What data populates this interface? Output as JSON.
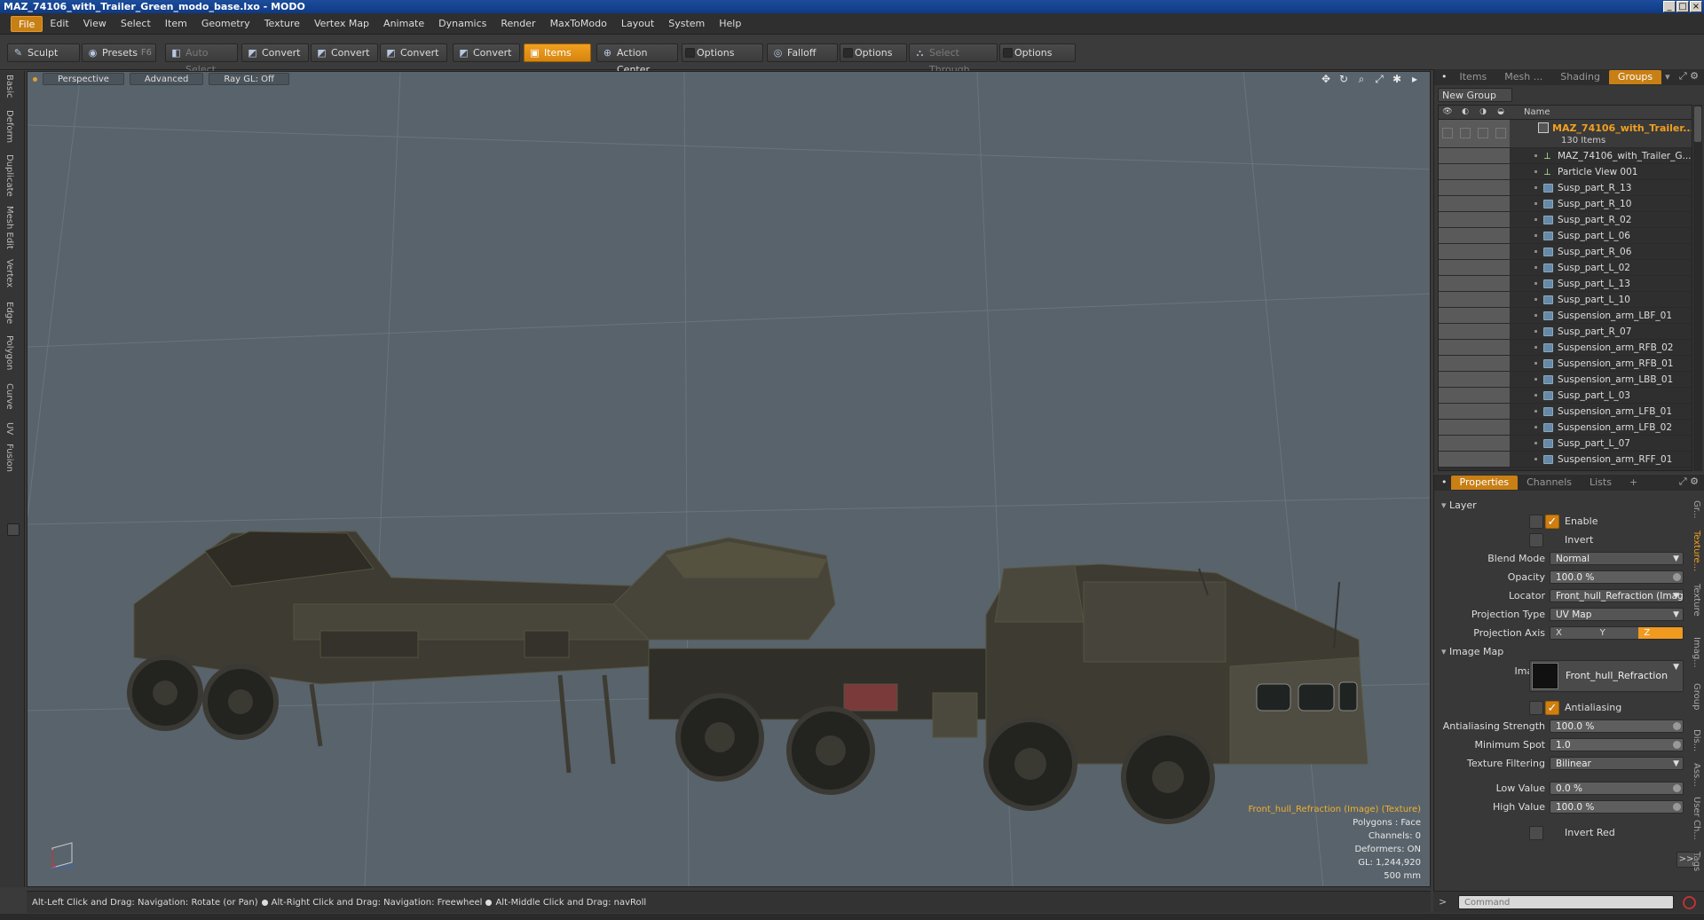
{
  "window": {
    "title": "MAZ_74106_with_Trailer_Green_modo_base.lxo - MODO"
  },
  "menu": [
    "File",
    "Edit",
    "View",
    "Select",
    "Item",
    "Geometry",
    "Texture",
    "Vertex Map",
    "Animate",
    "Dynamics",
    "Render",
    "MaxToModo",
    "Layout",
    "System",
    "Help"
  ],
  "toolbar": {
    "sculpt": "Sculpt",
    "presets": "Presets",
    "presets_key": "F6",
    "auto_select": "Auto Select",
    "convert": "Convert",
    "items": "Items",
    "action_center": "Action Center",
    "options": "Options",
    "falloff": "Falloff",
    "select_through": "Select Through"
  },
  "left_tabs": [
    "Basic",
    "Deform",
    "Duplicate",
    "Mesh Edit",
    "Vertex",
    "Edge",
    "Polygon",
    "Curve",
    "UV",
    "Fusion"
  ],
  "viewport": {
    "perspective": "Perspective",
    "advanced": "Advanced",
    "raygl": "Ray GL: Off",
    "info": {
      "selected": "Front_hull_Refraction (Image) (Texture)",
      "polygons": "Polygons : Face",
      "channels": "Channels: 0",
      "deformers": "Deformers: ON",
      "gl": "GL: 1,244,920",
      "scale": "500 mm"
    }
  },
  "statusbar": {
    "hint1": "Alt-Left Click and Drag: Navigation: Rotate (or Pan)",
    "hint2": "Alt-Right Click and Drag: Navigation: Freewheel",
    "hint3": "Alt-Middle Click and Drag: navRoll"
  },
  "groups_panel": {
    "tabs": [
      "Items",
      "Mesh ...",
      "Shading",
      "Groups"
    ],
    "selected_tab": "Groups",
    "new_group": "New Group",
    "col_name": "Name",
    "root_name": "MAZ_74106_with_Trailer...",
    "root_count": "130 Items",
    "items": [
      "MAZ_74106_with_Trailer_G...",
      "Particle View 001",
      "Susp_part_R_13",
      "Susp_part_R_10",
      "Susp_part_R_02",
      "Susp_part_L_06",
      "Susp_part_R_06",
      "Susp_part_L_02",
      "Susp_part_L_13",
      "Susp_part_L_10",
      "Suspension_arm_LBF_01",
      "Susp_part_R_07",
      "Suspension_arm_RFB_02",
      "Suspension_arm_RFB_01",
      "Suspension_arm_LBB_01",
      "Susp_part_L_03",
      "Suspension_arm_LFB_01",
      "Suspension_arm_LFB_02",
      "Susp_part_L_07",
      "Suspension_arm_RFF_01"
    ]
  },
  "properties_panel": {
    "tabs": [
      "Properties",
      "Channels",
      "Lists",
      "+"
    ],
    "layer_section": "Layer",
    "enable": "Enable",
    "invert": "Invert",
    "blend_mode_label": "Blend Mode",
    "blend_mode": "Normal",
    "opacity_label": "Opacity",
    "opacity": "100.0 %",
    "locator_label": "Locator",
    "locator": "Front_hull_Refraction (Imag ...",
    "projection_type_label": "Projection Type",
    "projection_type": "UV Map",
    "projection_axis_label": "Projection Axis",
    "axes": [
      "X",
      "Y",
      "Z"
    ],
    "image_map_section": "Image Map",
    "image_label": "Image",
    "image": "Front_hull_Refraction",
    "antialiasing": "Antialiasing",
    "aa_strength_label": "Antialiasing Strength",
    "aa_strength": "100.0 %",
    "min_spot_label": "Minimum Spot",
    "min_spot": "1.0",
    "tex_filter_label": "Texture Filtering",
    "tex_filter": "Bilinear",
    "low_value_label": "Low Value",
    "low_value": "0.0 %",
    "high_value_label": "High Value",
    "high_value": "100.0 %",
    "invert_red": "Invert Red",
    "more": ">>"
  },
  "right_vtabs": [
    "Gr...",
    "Texture...",
    "Texture",
    "Imag...",
    "Group",
    "Dis...",
    "Ass...",
    "User Ch...",
    "Tags"
  ],
  "command": {
    "placeholder": "Command"
  }
}
